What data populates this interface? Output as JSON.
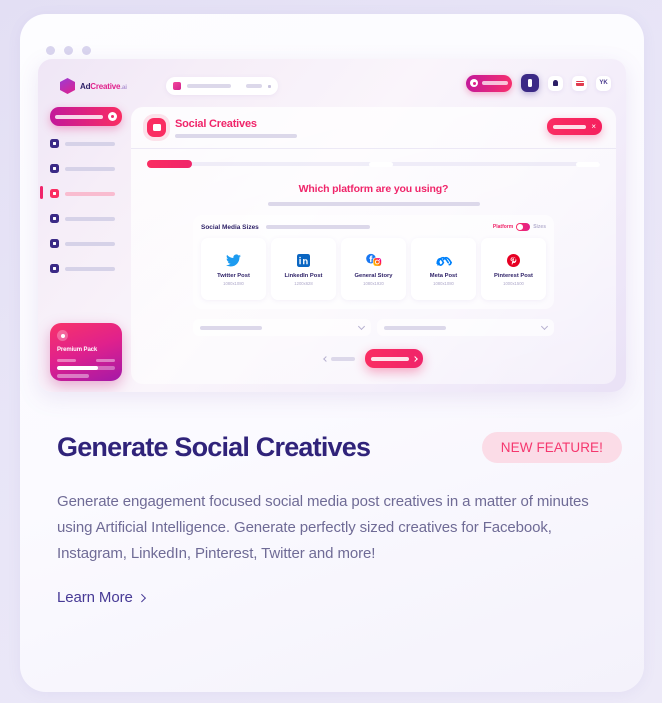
{
  "card": {
    "window_dots": 3
  },
  "mockup": {
    "brand": {
      "name_part1": "Ad",
      "name_part2": "Creative",
      "name_part3": ".ai",
      "logo_icon": "hexagon-cube-icon"
    },
    "topbar": {
      "search_icon": "brand-avatar-icon",
      "credits_icon": "coin-icon",
      "user_badge_icon": "crown-icon",
      "notification_icon": "bell-icon",
      "language_icon": "flag-icon",
      "avatar_initials": "YK"
    },
    "sidebar": {
      "cta_icon": "plus-circle-icon",
      "items": [
        {
          "icon": "dashboard-icon",
          "active": false
        },
        {
          "icon": "projects-icon",
          "active": false
        },
        {
          "icon": "social-creatives-icon",
          "active": true
        },
        {
          "icon": "brands-icon",
          "active": false
        },
        {
          "icon": "analytics-icon",
          "active": false
        },
        {
          "icon": "settings-icon",
          "active": false
        }
      ],
      "premium": {
        "title": "Premium Pack",
        "icon": "star-icon",
        "progress_percent": 70
      }
    },
    "panel": {
      "icon": "social-creatives-icon",
      "title": "Social Creatives",
      "close_icon": "close-x-icon",
      "close_label": "×",
      "question": "Which platform are you using?",
      "sizes_label": "Social Media Sizes",
      "toggle_left": "Platform",
      "toggle_right": "Sizes",
      "platforms": [
        {
          "name": "Twitter Post",
          "dimensions": "1080x1080",
          "icon": "twitter-icon"
        },
        {
          "name": "LinkedIn Post",
          "dimensions": "1200x628",
          "icon": "linkedin-icon"
        },
        {
          "name": "General Story",
          "dimensions": "1080x1920",
          "icon": "facebook-instagram-icon"
        },
        {
          "name": "Meta Post",
          "dimensions": "1080x1080",
          "icon": "meta-icon"
        },
        {
          "name": "Pinterest Post",
          "dimensions": "1000x1500",
          "icon": "pinterest-icon"
        }
      ],
      "back_icon": "chevron-left-icon",
      "next_icon": "chevron-right-icon"
    }
  },
  "feature": {
    "headline": "Generate Social Creatives",
    "badge": "NEW FEATURE!",
    "description": "Generate engagement focused social media post creatives in a matter of minutes using Artificial Intelligence. Generate perfectly sized creatives for Facebook, Instagram, LinkedIn, Pinterest, Twitter and more!",
    "cta_label": "Learn More",
    "cta_icon": "chevron-right-icon"
  },
  "colors": {
    "accent_pink": "#f0256a",
    "accent_magenta": "#e0218c",
    "heading_purple": "#30237a",
    "body_text": "#6f6b96",
    "badge_bg": "#fbdce7",
    "page_bg": "#e7e4f6"
  }
}
